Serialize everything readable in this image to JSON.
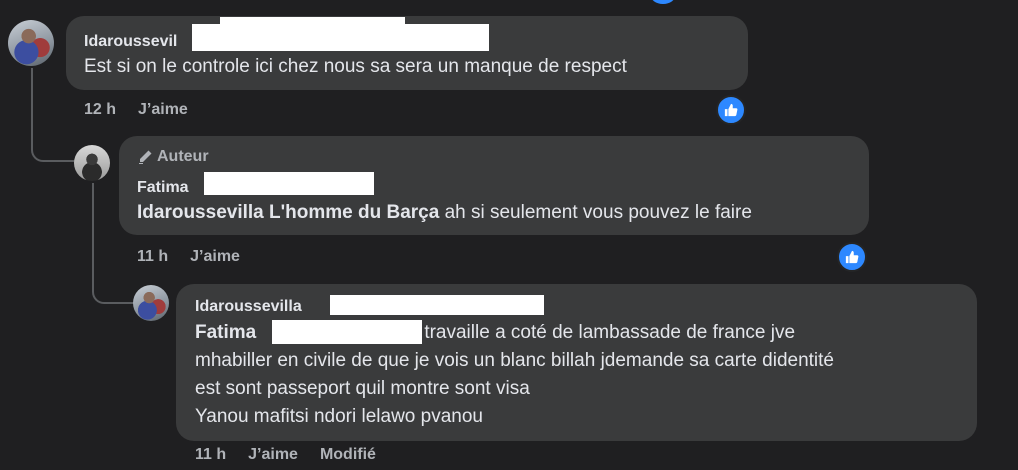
{
  "comments": [
    {
      "author": "Idaroussevil",
      "text": "Est si on le controle ici chez nous sa sera un manque de respect",
      "time": "12 h",
      "like_label": "J’aime"
    },
    {
      "badge": "Auteur",
      "author": "Fatima",
      "mention": "Idaroussevilla L'homme du Barça",
      "text": " ah si seulement vous pouvez le faire",
      "time": "11 h",
      "like_label": "J’aime"
    },
    {
      "author": "Idaroussevilla",
      "mention": "Fatima",
      "text_lines": [
        "je travaille a coté de lambassade de france jve",
        "mhabiller en civile de que je vois un blanc billah jdemande sa carte didentité",
        "est sont passeport quil montre sont visa",
        "Yanou mafitsi ndori lelawo pvanou"
      ],
      "time": "11 h",
      "like_label": "J’aime",
      "edited_label": "Modifié"
    }
  ],
  "colors": {
    "background": "#1f1f21",
    "bubble": "#3a3b3c",
    "text": "#e4e6eb",
    "meta": "#b0b3b8",
    "like_blue": "#2d88ff"
  },
  "icons": {
    "like": "thumbs-up-icon",
    "author_badge": "pencil-icon"
  }
}
